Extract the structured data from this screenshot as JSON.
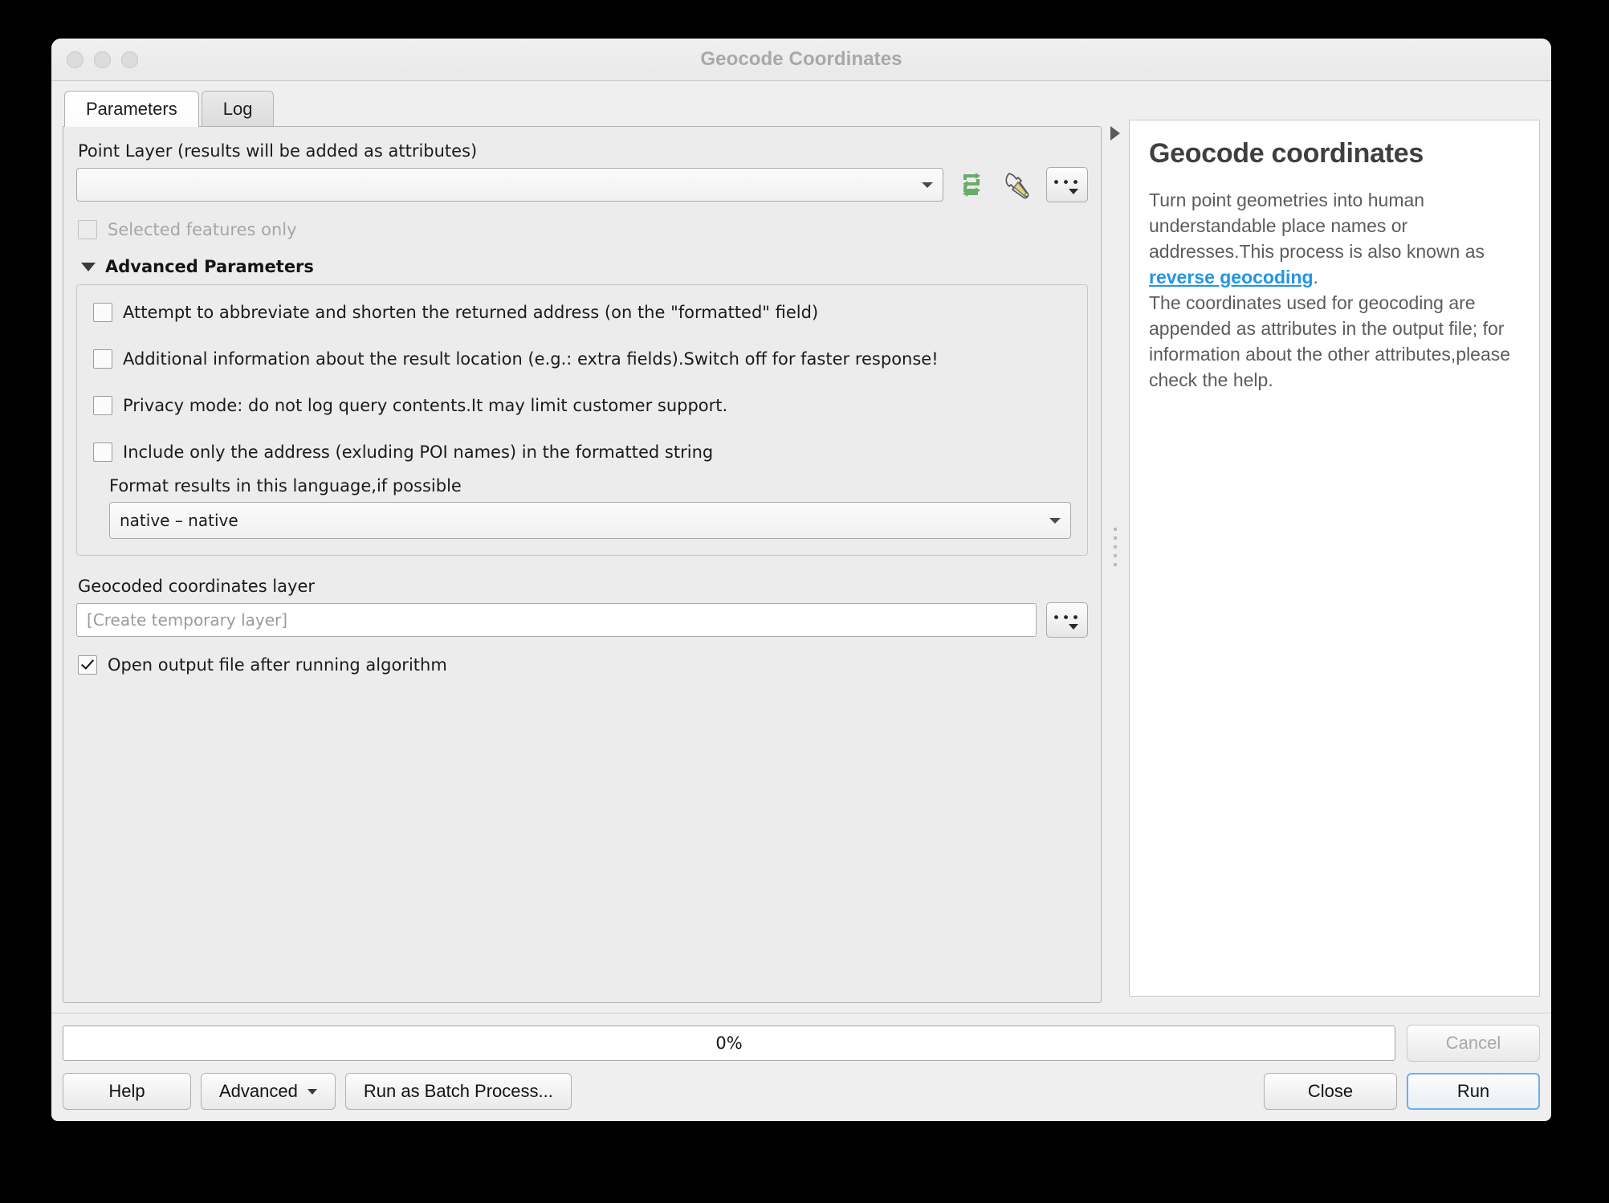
{
  "window": {
    "title": "Geocode Coordinates",
    "traffic_lights": [
      "close-button",
      "minimize-button",
      "zoom-button"
    ]
  },
  "tabs": [
    {
      "label": "Parameters",
      "active": true
    },
    {
      "label": "Log",
      "active": false
    }
  ],
  "parameters": {
    "point_layer": {
      "label": "Point Layer (results will be added as attributes)",
      "value": "",
      "icons": [
        "iterate-icon",
        "data-defined-override-icon",
        "more-options-icon"
      ]
    },
    "selected_features_only": {
      "label": "Selected features only",
      "checked": false,
      "enabled": false
    },
    "advanced_section": {
      "label": "Advanced Parameters",
      "expanded": true,
      "checkboxes": [
        {
          "label": "Attempt to abbreviate and shorten the returned address (on the \"formatted\" field)",
          "checked": false
        },
        {
          "label": "Additional information about the result location (e.g.: extra fields).Switch off for faster response!",
          "checked": false
        },
        {
          "label": "Privacy mode: do not log query contents.It may limit customer support.",
          "checked": false
        },
        {
          "label": " Include only the address (exluding POI names) in the formatted string",
          "checked": false
        }
      ],
      "language": {
        "label": "Format results in this language,if possible",
        "value": "native – native"
      }
    },
    "output": {
      "label": "Geocoded coordinates layer",
      "placeholder": "[Create temporary layer]",
      "value": "",
      "browse_label": "more-options-icon"
    },
    "open_output": {
      "label": "Open output file after running algorithm",
      "checked": true
    }
  },
  "help": {
    "title": "Geocode coordinates",
    "paragraph_1_before_link": "Turn point geometries into human understandable place names or addresses.This process is also known as ",
    "link_text": "reverse geocoding",
    "paragraph_1_after_link": ".",
    "paragraph_2": "The coordinates used for geocoding are appended as attributes in the output file; for information about the other attributes,please check the help."
  },
  "footer": {
    "progress_text": "0%",
    "progress_percent": 0,
    "cancel_label": "Cancel",
    "cancel_enabled": false,
    "help_label": "Help",
    "advanced_label": "Advanced",
    "batch_label": "Run as Batch Process...",
    "close_label": "Close",
    "run_label": "Run"
  },
  "colors": {
    "link": "#2196e3",
    "default_button_border": "#6aaff0",
    "iterate_icon": "#6aab6a",
    "wrench_handle": "#e8cf7a",
    "disabled_text": "#a6a6a6"
  }
}
